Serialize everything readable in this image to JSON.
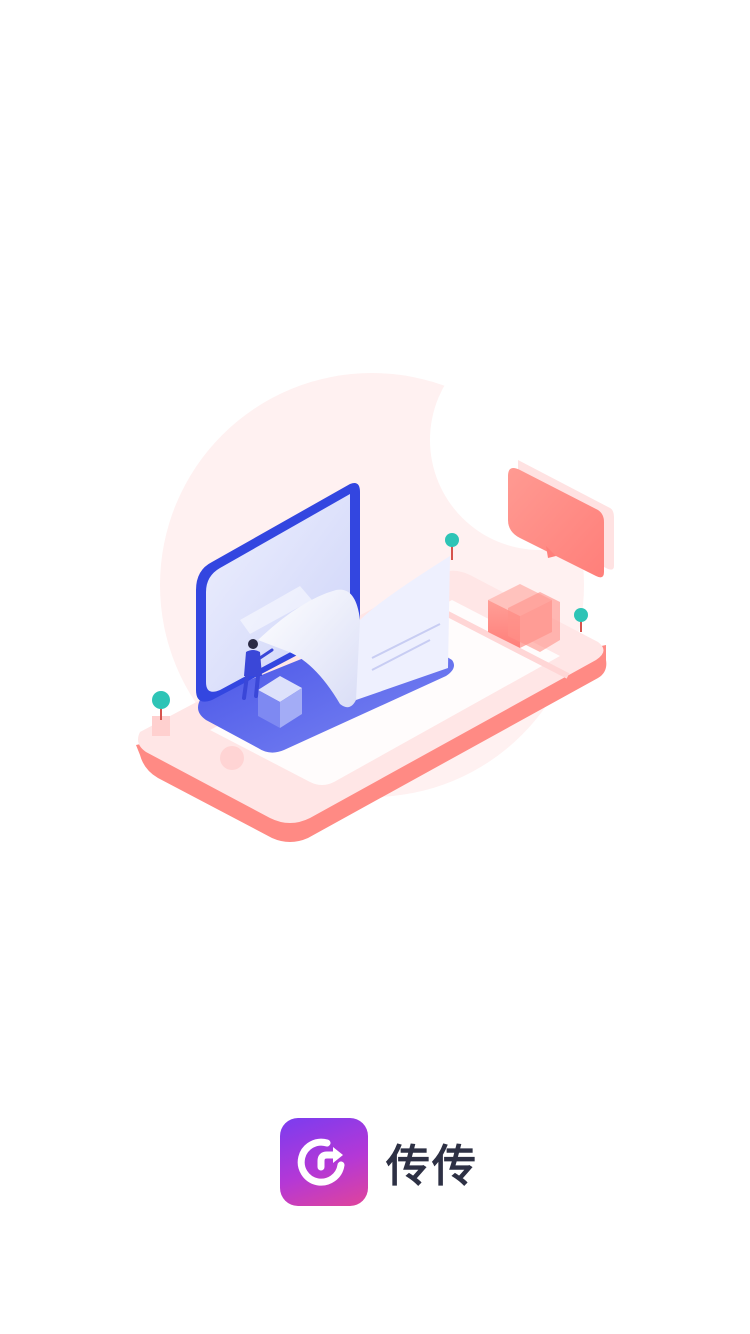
{
  "splash": {
    "illustration_icon": "phone-file-transfer-illustration",
    "colors": {
      "blob": "#fff1f1",
      "phone_top": "#ffe3e3",
      "phone_side": "#ff8a84",
      "laptop_blue": "#3346e0",
      "laptop_screen": "#dfe3fb",
      "accent_teal": "#2ec4b6"
    }
  },
  "brand": {
    "icon": "refresh-arrow-icon",
    "app_name": "传传",
    "icon_gradient": [
      "#7a3cf0",
      "#e0449a"
    ]
  }
}
